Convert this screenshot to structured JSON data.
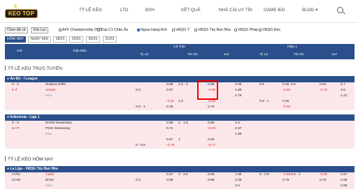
{
  "nav": {
    "logo_text": "KEO TOP",
    "items": [
      "TỶ LỆ KÈO",
      "LTD",
      "BXH",
      "KẾT QUẢ",
      "NHÀ CÁI UY TÍN",
      "GAME BÀI",
      "BLOG"
    ]
  },
  "filters": {
    "select_all": "Chọn tất cả",
    "clear_all": "Xóa Lọc",
    "leagues": [
      {
        "label": "AFF Championship 2022",
        "checked": false
      },
      {
        "label": "Cúp C1 Châu Âu",
        "checked": false
      },
      {
        "label": "Ngoại Hạng Anh",
        "checked": true
      },
      {
        "label": "VĐQG Ý",
        "checked": false
      },
      {
        "label": "VĐQG Tây Ban Nha",
        "checked": false
      },
      {
        "label": "VĐQG Pháp",
        "checked": false
      },
      {
        "label": "VĐQG Đức",
        "checked": false
      }
    ],
    "days": [
      "HÔM NAY",
      "NGÀY MAI",
      "18/01",
      "19/01",
      "20/01",
      "21/01"
    ]
  },
  "table_header": {
    "col_time": "Giờ",
    "col_match": "Trận Đấu",
    "group_full": "Cả Trận",
    "group_half": "Hiệp 1",
    "full_sub": [
      "Tỷ Lệ",
      "Tài Xỉu",
      "1x2"
    ],
    "half_sub": [
      "Tỷ Lệ",
      "Tài Xỉu",
      "1x2"
    ]
  },
  "live_section_title": "TỶ LỆ KÈO TRỰC TUYẾN",
  "today_section_title": "TỶ LỆ KÈO HÔM NAY",
  "leagues_live": [
    {
      "name": "Ấn Độ - I League",
      "rows": [
        {
          "t1": "0 - 0",
          "t2": "",
          "team": "Sudeva Delhi",
          "f_hdp_line": "",
          "f_hdp_odds": "0.89",
          "f_ou_line": "1.5 - 2",
          "f_ou_odds": "0.88",
          "x": "4.05",
          "h_hdp_line": "0.5",
          "h_hdp_odds": "0.46",
          "h_ou_line": "0.5",
          "h_ou_odds": "0.54",
          "hx": "6.7",
          "cls": "pink"
        },
        {
          "t1": "● 3'",
          "t2": "",
          "team": "Aizawl",
          "f_hdp_line": "0.5",
          "f_hdp_odds": "0.97",
          "f_ou_line": "",
          "f_ou_odds": "-0.99",
          "x": "1.96",
          "h_hdp_line": "",
          "h_hdp_odds": "-0.60",
          "h_ou_line": "",
          "h_ou_odds": "-0.70",
          "hx": "3.6",
          "cls": "pink"
        },
        {
          "t1": "",
          "t2": "",
          "team": "Hòa",
          "f_hdp_line": "",
          "f_hdp_odds": "",
          "f_ou_line": "",
          "f_ou_odds": "",
          "x": "2.76",
          "h_hdp_line": "",
          "h_hdp_odds": "",
          "h_ou_line": "",
          "h_ou_odds": "",
          "hx": "1.41",
          "cls": "pink"
        },
        {
          "t1": "",
          "t2": "",
          "team": "",
          "f_hdp_line": "",
          "f_hdp_odds": "-0.61",
          "f_ou_line": "1.5",
          "f_ou_odds": "-0.93",
          "x": "",
          "h_hdp_line": "0.5 - 1",
          "h_hdp_odds": "0.26",
          "h_ou_line": "",
          "h_ou_odds": "",
          "hx": "",
          "cls": "pink"
        },
        {
          "t1": "",
          "t2": "",
          "team": "",
          "f_hdp_line": "0.5 - 1",
          "f_hdp_odds": "0.46",
          "f_ou_line": "",
          "f_ou_odds": "0.75",
          "x": "",
          "h_hdp_line": "",
          "h_hdp_odds": "-0.38",
          "h_ou_line": "",
          "h_ou_odds": "",
          "hx": "",
          "cls": "pink"
        }
      ]
    },
    {
      "name": "Indonesia - Liga 1",
      "rows": [
        {
          "t1": "0 - 0",
          "t2": "",
          "team": "RANS Nusantara",
          "f_hdp_line": "",
          "f_hdp_odds": "0.86",
          "f_ou_line": "1 - 1.5",
          "f_ou_odds": "0.80",
          "x": "3.3",
          "h_hdp_line": "",
          "h_hdp_odds": "",
          "h_ou_line": "",
          "h_ou_odds": "",
          "hx": "",
          "cls": "pink"
        },
        {
          "t1": "● HT",
          "t2": "",
          "team": "PSIS Semarang",
          "f_hdp_line": "",
          "f_hdp_odds": "0.74",
          "f_ou_line": "",
          "f_ou_odds": "-0.94",
          "x": "2.67",
          "h_hdp_line": "",
          "h_hdp_odds": "",
          "h_ou_line": "",
          "h_ou_odds": "",
          "hx": "",
          "cls": "pink"
        },
        {
          "t1": "",
          "t2": "",
          "team": "Hòa",
          "f_hdp_line": "",
          "f_hdp_odds": "",
          "f_ou_line": "",
          "f_ou_odds": "",
          "x": "1.96",
          "h_hdp_line": "",
          "h_hdp_odds": "",
          "h_ou_line": "",
          "h_ou_odds": "",
          "hx": "",
          "cls": "pink"
        },
        {
          "t1": "",
          "t2": "",
          "team": "",
          "f_hdp_line": "",
          "f_hdp_odds": "0.67",
          "f_ou_line": "1",
          "f_ou_odds": "0.63",
          "x": "",
          "h_hdp_line": "",
          "h_hdp_odds": "",
          "h_ou_line": "",
          "h_ou_odds": "",
          "hx": "",
          "cls": "pink"
        },
        {
          "t1": "",
          "t2": "",
          "team": "",
          "f_hdp_line": "0 - 0.5",
          "f_hdp_odds": "-0.79",
          "f_ou_line": "",
          "f_ou_odds": "-0.77",
          "x": "",
          "h_hdp_line": "",
          "h_hdp_odds": "",
          "h_ou_line": "",
          "h_ou_odds": "",
          "hx": "",
          "cls": "pink"
        }
      ]
    }
  ],
  "leagues_today": [
    {
      "name": "La Liga - VĐQG Tây Ban Nha",
      "rows": [
        {
          "t1": "17/01",
          "t2": "",
          "team": "Cadiz",
          "f_hdp_line": "",
          "f_hdp_odds": "0.97",
          "f_ou_line": "2 - 2.5",
          "f_ou_odds": "0.90",
          "x": "1.96",
          "h_hdp_line": "0 - 0.5",
          "h_hdp_odds": "-0.88",
          "h_ou_line": "0.5 - 1",
          "h_ou_odds": "-0.85",
          "hx": "2.67",
          "cls": "pink"
        },
        {
          "t1": "01:00",
          "t2": "",
          "team": "Elche",
          "f_hdp_line": "0.5",
          "f_hdp_odds": "0.95",
          "f_ou_line": "",
          "f_ou_odds": "0.96",
          "x": "4.25",
          "h_hdp_line": "",
          "h_hdp_odds": "0.78",
          "h_ou_line": "",
          "h_ou_odds": "0.75",
          "hx": "4.65",
          "cls": "pink"
        },
        {
          "t1": "",
          "t2": "",
          "team": "Hòa",
          "f_hdp_line": "",
          "f_hdp_odds": "",
          "f_ou_line": "",
          "f_ou_odds": "",
          "x": "3.4",
          "h_hdp_line": "",
          "h_hdp_odds": "",
          "h_ou_line": "",
          "h_ou_odds": "",
          "hx": "2.08",
          "cls": "pink"
        }
      ]
    }
  ],
  "colors": {
    "header_blue": "#2a4f8c",
    "row_pink": "#fbe7ea",
    "negative_red": "#d22",
    "highlight": "#e00"
  }
}
